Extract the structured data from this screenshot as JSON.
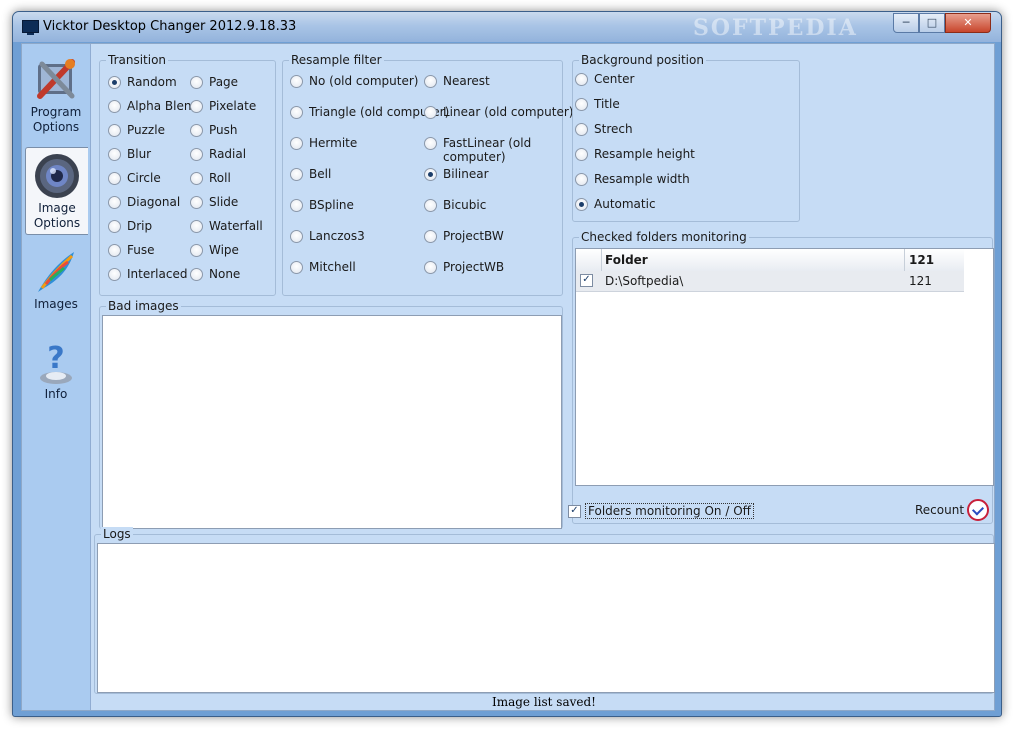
{
  "window": {
    "title": "Vicktor Desktop Changer 2012.9.18.33",
    "watermark": "SOFTPEDIA",
    "minimize_label": "─",
    "maximize_label": "□",
    "close_label": "✕"
  },
  "sidebar": {
    "items": [
      {
        "line1": "Program",
        "line2": "Options",
        "icon": "tools-icon"
      },
      {
        "line1": "Image",
        "line2": "Options",
        "icon": "lens-icon",
        "active": true
      },
      {
        "label": "Images",
        "icon": "feather-icon"
      },
      {
        "label": "Info",
        "icon": "question-icon"
      }
    ]
  },
  "transition": {
    "title": "Transition",
    "options": [
      "Random",
      "Page",
      "Alpha Blend",
      "Pixelate",
      "Puzzle",
      "Push",
      "Blur",
      "Radial",
      "Circle",
      "Roll",
      "Diagonal",
      "Slide",
      "Drip",
      "Waterfall",
      "Fuse",
      "Wipe",
      "Interlaced",
      "None"
    ],
    "selected": "Random"
  },
  "resample": {
    "title": "Resample filter",
    "options": [
      "No (old computer)",
      "Nearest",
      "Triangle (old computer)",
      "Linear (old computer)",
      "Hermite",
      "FastLinear (old computer)",
      "Bell",
      "Bilinear",
      "BSpline",
      "Bicubic",
      "Lanczos3",
      "ProjectBW",
      "Mitchell",
      "ProjectWB"
    ],
    "selected": "Bilinear"
  },
  "background": {
    "title": "Background position",
    "options": [
      "Center",
      "Title",
      "Strech",
      "Resample height",
      "Resample width",
      "Automatic"
    ],
    "selected": "Automatic"
  },
  "bad_images": {
    "title": "Bad images"
  },
  "folders": {
    "title": "Checked folders monitoring",
    "col_folder": "Folder",
    "col_count": "121",
    "rows": [
      {
        "checked": true,
        "folder": "D:\\Softpedia\\",
        "count": "121"
      }
    ],
    "monitoring_label": "Folders monitoring On / Off",
    "monitoring_on": true,
    "recount_label": "Recount",
    "check_mark": "✓"
  },
  "logs": {
    "title": "Logs"
  },
  "status": {
    "text": "Image list saved!"
  }
}
